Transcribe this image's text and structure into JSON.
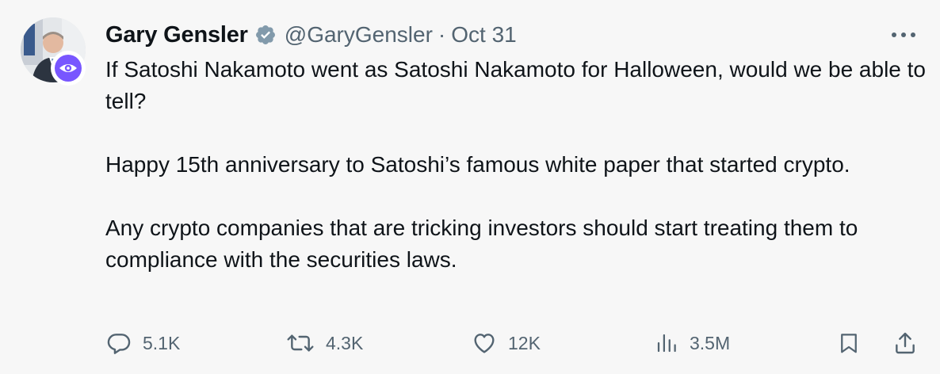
{
  "author": {
    "name": "Gary Gensler",
    "handle": "@GaryGensler",
    "separator": "·",
    "date": "Oct 31",
    "verified_icon": "verified-check-icon",
    "badge_icon": "eye-icon"
  },
  "tweet": {
    "paragraphs": [
      "If Satoshi Nakamoto went as Satoshi Nakamoto for Halloween, would we be able to tell?",
      "Happy 15th anniversary to Satoshi’s famous white paper that started crypto.",
      "Any crypto companies that are tricking investors should start treating them to compliance with the securities laws."
    ]
  },
  "actions": {
    "replies": "5.1K",
    "reposts": "4.3K",
    "likes": "12K",
    "views": "3.5M"
  },
  "colors": {
    "background": "#f7f7f7",
    "text": "#0f1419",
    "muted": "#536471",
    "verified": "#829aab",
    "badge": "#7856ff"
  }
}
